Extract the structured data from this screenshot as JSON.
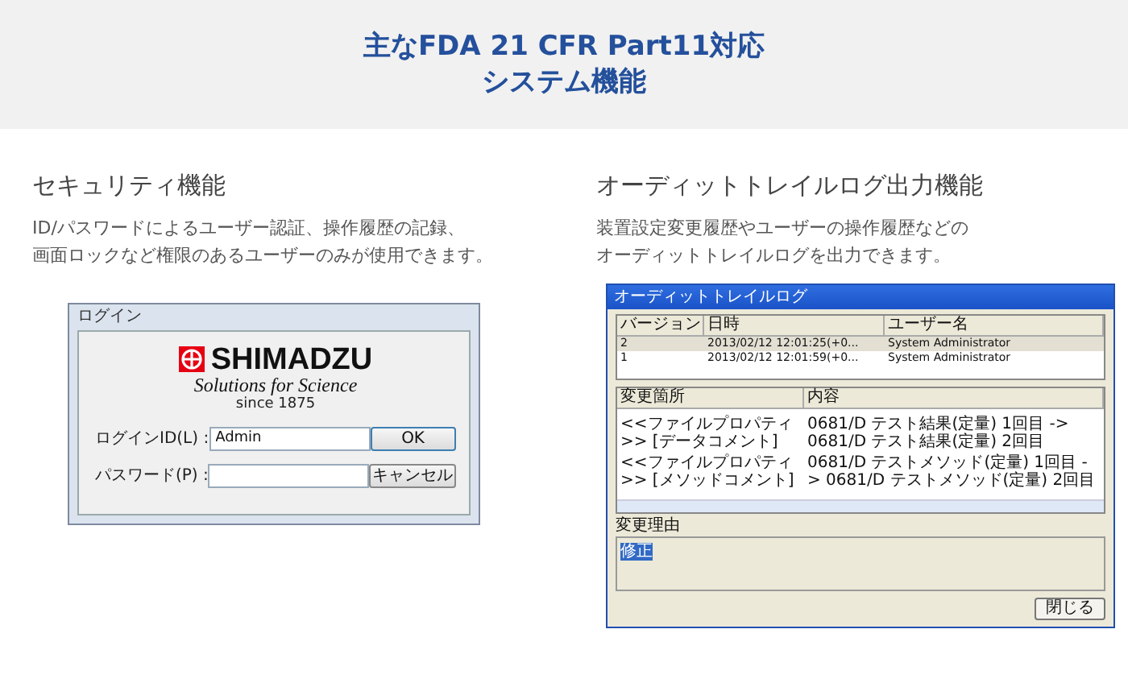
{
  "header": {
    "title_lines": [
      "主なFDA 21 CFR Part11対応",
      "システム機能"
    ]
  },
  "features": [
    {
      "heading": "セキュリティ機能",
      "description_lines": [
        "ID/パスワードによるユーザー認証、操作履歴の記録、",
        "画面ロックなど権限のあるユーザーのみが使用できます。"
      ],
      "screenshot": {
        "kind": "login",
        "title": "ログイン",
        "logo": {
          "wordmark": "SHIMADZU",
          "tagline": "Solutions for Science",
          "since": "since 1875"
        },
        "fields": [
          {
            "label": "ログインID(L) :",
            "value": "Admin",
            "button": "OK",
            "default": true
          },
          {
            "label": "パスワード(P) :",
            "button": "キャンセル",
            "default": false
          }
        ]
      }
    },
    {
      "heading": "オーディットトレイルログ出力機能",
      "description_lines": [
        "装置設定変更履歴やユーザーの操作履歴などの",
        "オーディットトレイルログを出力できます。"
      ],
      "screenshot": {
        "kind": "audit",
        "title": "オーディットトレイルログ",
        "versions": {
          "columns": [
            "バージョン",
            "日時",
            "ユーザー名"
          ],
          "rows": [
            {
              "cells": [
                "2",
                "2013/02/12 12:01:25(+0...",
                "System Administrator"
              ],
              "selected": true
            },
            {
              "cells": [
                "1",
                "2013/02/12 12:01:59(+0...",
                "System Administrator"
              ],
              "selected": false
            }
          ]
        },
        "changes": {
          "columns": [
            "変更箇所",
            "内容"
          ],
          "rows": [
            [
              "<<ファイルプロパティ>> [データコメント]",
              "0681/D テスト結果(定量) 1回目 -> 0681/D テスト結果(定量) 2回目"
            ],
            [
              "<<ファイルプロパティ>> [メソッドコメント]",
              "0681/D テストメソッド(定量) 1回目 -> 0681/D テストメソッド(定量) 2回目"
            ]
          ]
        },
        "reason": {
          "label": "変更理由",
          "value": "修正",
          "selected": true
        },
        "close_button": "閉じる"
      }
    }
  ]
}
